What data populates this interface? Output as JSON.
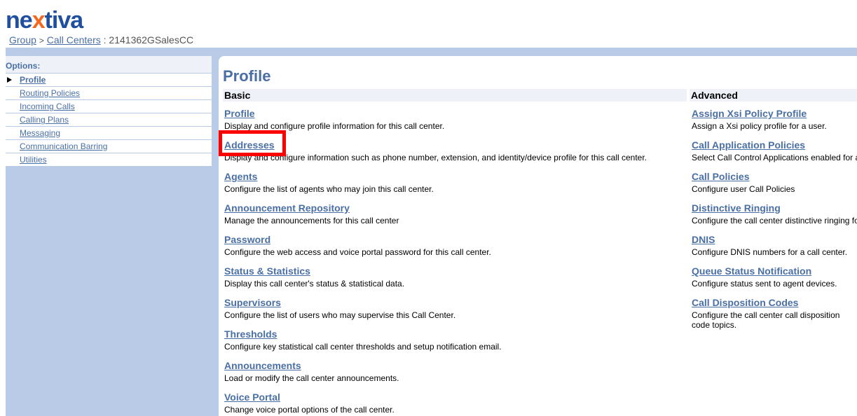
{
  "logo": {
    "text_pre": "ne",
    "text_x": "x",
    "text_post": "tiva"
  },
  "breadcrumb": {
    "group": "Group",
    "sep": ">",
    "call_centers": "Call Centers",
    "current": ": 2141362GSalesCC"
  },
  "nav": {
    "title": "Options:",
    "items": [
      {
        "label": "Profile",
        "active": true
      },
      {
        "label": "Routing Policies"
      },
      {
        "label": "Incoming Calls"
      },
      {
        "label": "Calling Plans"
      },
      {
        "label": "Messaging"
      },
      {
        "label": "Communication Barring"
      },
      {
        "label": "Utilities"
      }
    ]
  },
  "main": {
    "title": "Profile",
    "basic_heading": "Basic",
    "advanced_heading": "Advanced",
    "basic": [
      {
        "label": "Profile",
        "desc": "Display and configure profile information for this call center."
      },
      {
        "label": "Addresses",
        "desc": "Display and configure information such as phone number, extension, and identity/device profile for this call center."
      },
      {
        "label": "Agents",
        "desc": "Configure the list of agents who may join this call center."
      },
      {
        "label": "Announcement Repository",
        "desc": "Manage the announcements for this call center"
      },
      {
        "label": "Password",
        "desc": "Configure the web access and voice portal password for this call center."
      },
      {
        "label": "Status & Statistics",
        "desc": "Display this call center's status & statistical data."
      },
      {
        "label": "Supervisors",
        "desc": "Configure the list of users who may supervise this Call Center."
      },
      {
        "label": "Thresholds",
        "desc": "Configure key statistical call center thresholds and setup notification email."
      },
      {
        "label": "Announcements",
        "desc": "Load or modify the call center announcements."
      },
      {
        "label": "Voice Portal",
        "desc": "Change voice portal options of the call center."
      }
    ],
    "advanced": [
      {
        "label": "Assign Xsi Policy Profile",
        "desc": "Assign a Xsi policy profile for a user."
      },
      {
        "label": "Call Application Policies",
        "desc": "Select Call Control Applications enabled for a"
      },
      {
        "label": "Call Policies",
        "desc": "Configure user Call Policies"
      },
      {
        "label": "Distinctive Ringing",
        "desc": "Configure the call center distinctive ringing fo"
      },
      {
        "label": "DNIS",
        "desc": "Configure DNIS numbers for a call center."
      },
      {
        "label": "Queue Status Notification",
        "desc": "Configure status sent to agent devices."
      },
      {
        "label": "Call Disposition Codes",
        "desc": "Configure the call center call disposition code topics."
      }
    ]
  }
}
